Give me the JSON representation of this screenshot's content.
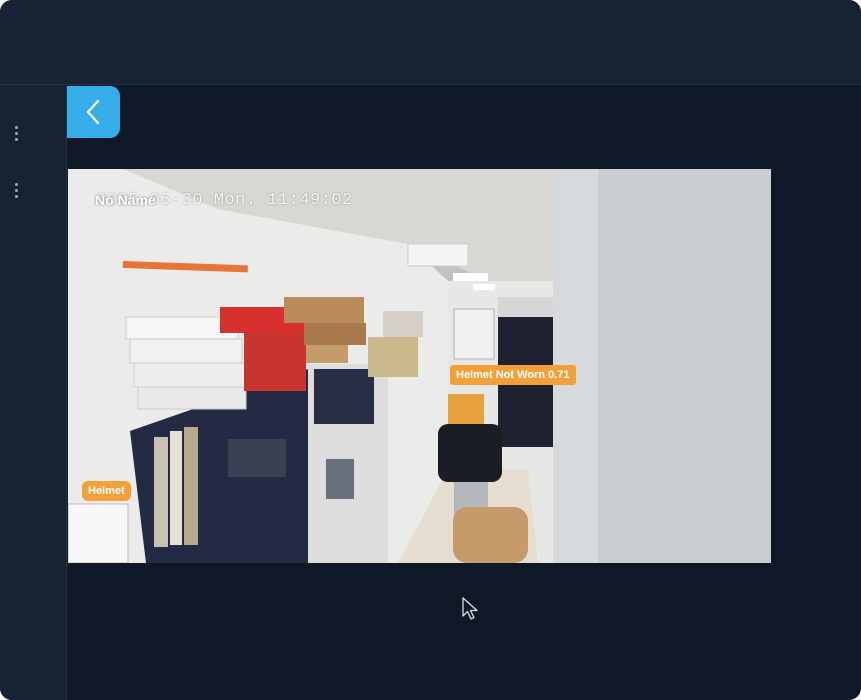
{
  "camera": {
    "name": "No Name",
    "timestamp": "2025-06-30 Mon. 11:49:02"
  },
  "detections": [
    {
      "label": "Helmet Not Worn 0.71",
      "color": "#f2a03a"
    },
    {
      "label": "Helmet",
      "color": "#f2a03a"
    }
  ],
  "sidebar": {
    "menus": [
      {
        "icon": "kebab-menu-icon"
      },
      {
        "icon": "kebab-menu-icon"
      }
    ]
  },
  "back_button": {
    "icon": "chevron-left-icon",
    "color": "#35aee9"
  },
  "theme": {
    "background": "#0f1826",
    "panel": "#172232"
  }
}
